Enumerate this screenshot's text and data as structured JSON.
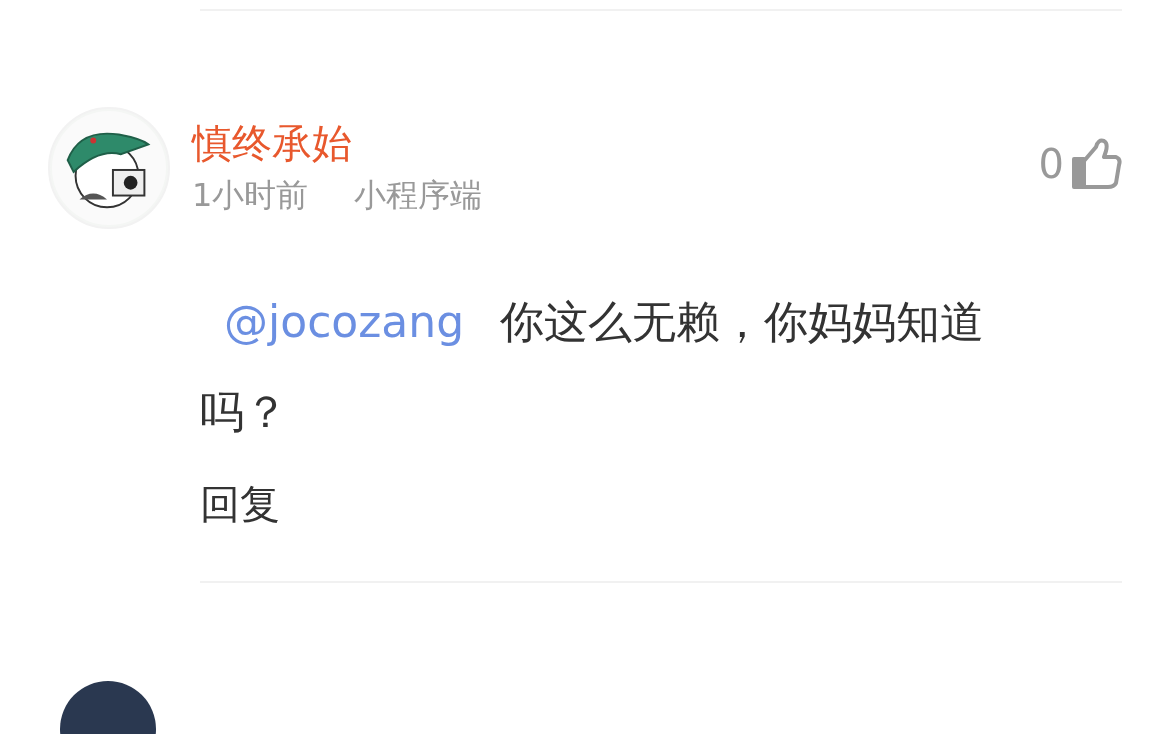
{
  "comment": {
    "author": "慎终承始",
    "time": "1小时前",
    "source": "小程序端",
    "like_count": "0",
    "mention": "@jocozang",
    "text": "你这么无赖，你妈妈知道吗？",
    "reply": "回复"
  }
}
